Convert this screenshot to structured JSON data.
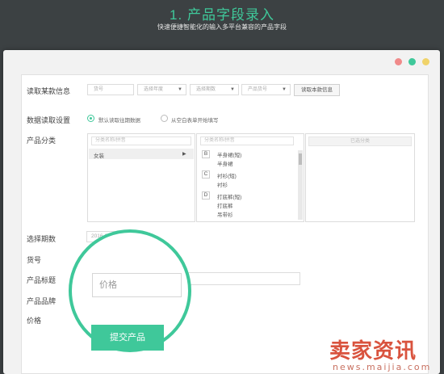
{
  "header": {
    "title": "1. 产品字段录入",
    "subtitle": "快速便捷智能化的输入多平台兼容的产品字段"
  },
  "window_dots": [
    "#f08a8a",
    "#3fc89a",
    "#f0d36a"
  ],
  "form": {
    "read_label": "读取某款信息",
    "read_selects": [
      {
        "placeholder": "货号",
        "arrow": false
      },
      {
        "placeholder": "选择年度",
        "arrow": true
      },
      {
        "placeholder": "选择期数",
        "arrow": true
      },
      {
        "placeholder": "产品货号",
        "arrow": true
      }
    ],
    "read_button": "读取本款信息",
    "settings_label": "数据读取设置",
    "radio_options": [
      "默认读取往期数据",
      "从空白表单开始填写"
    ],
    "radio_selected": 0,
    "category_label": "产品分类",
    "cat_search_placeholder": "分类名称/拼音",
    "cat_search_placeholder_2": "分类名称/拼音",
    "selected_header": "已选分类",
    "level1": [
      {
        "name": "女装",
        "arrow": "▶"
      }
    ],
    "level2": [
      {
        "letter": "B",
        "items": [
          "半身裙(短)",
          "半身裙"
        ]
      },
      {
        "letter": "C",
        "items": [
          "衬衫(短)",
          "衬衫"
        ]
      },
      {
        "letter": "D",
        "items": [
          "打底裤(短)",
          "打底裤",
          "吊带衫"
        ]
      }
    ],
    "period_label": "选择期数",
    "period_value": "2016-02-02",
    "sku_label": "货号",
    "title_label": "产品标题",
    "brand_label": "产品品牌",
    "price_label": "价格",
    "price_placeholder": "价格",
    "submit_label": "提交产品"
  },
  "watermark": {
    "text": "卖家资讯",
    "url": "news.maijia.com"
  },
  "colors": {
    "accent": "#3fc89a",
    "background": "#3c4143"
  }
}
